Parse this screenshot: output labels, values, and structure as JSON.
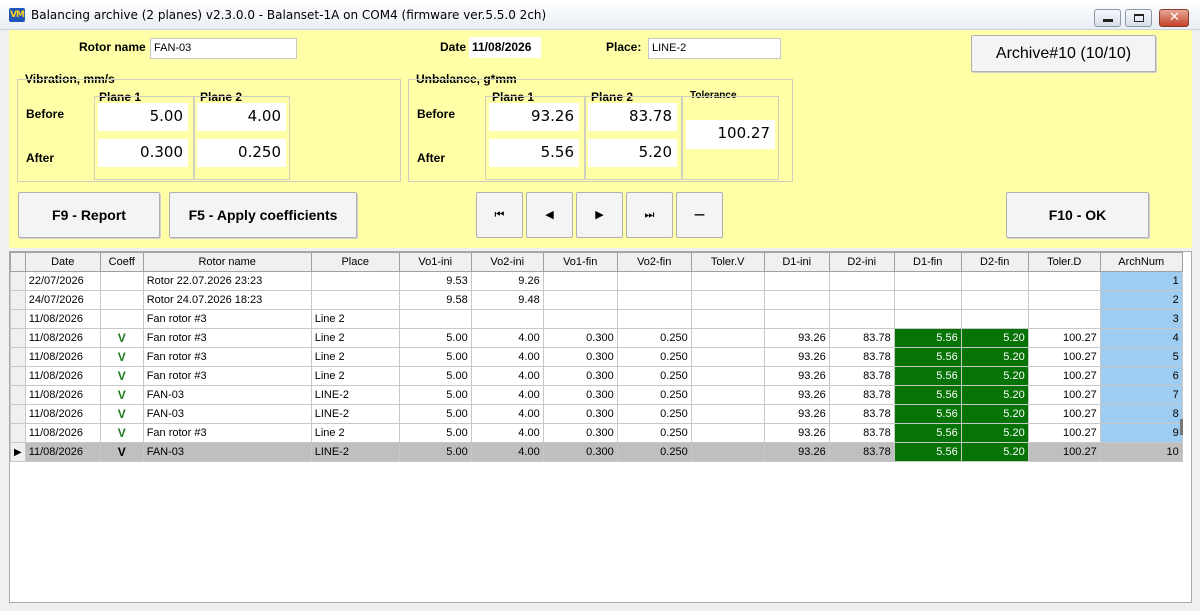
{
  "window": {
    "title": "Balancing archive (2 planes) v2.3.0.0 - Balanset-1A on COM4 (firmware ver.5.5.0 2ch)",
    "icon_text": "VM"
  },
  "header": {
    "rotor_name_label": "Rotor name",
    "rotor_name_value": "FAN-03",
    "date_label": "Date",
    "date_value": "11/08/2026",
    "place_label": "Place:",
    "place_value": "LINE-2",
    "archive_button": "Archive#10 (10/10)"
  },
  "vibration": {
    "title": "Vibration, mm/s",
    "plane1": "Plane 1",
    "plane2": "Plane 2",
    "before_label": "Before",
    "after_label": "After",
    "before_p1": "5.00",
    "before_p2": "4.00",
    "after_p1": "0.300",
    "after_p2": "0.250"
  },
  "unbalance": {
    "title": "Unbalance, g*mm",
    "plane1": "Plane 1",
    "plane2": "Plane 2",
    "tolerance_label": "Tolerance",
    "before_label": "Before",
    "after_label": "After",
    "before_p1": "93.26",
    "before_p2": "83.78",
    "after_p1": "5.56",
    "after_p2": "5.20",
    "tolerance": "100.27"
  },
  "buttons": {
    "report": "F9 - Report",
    "apply": "F5 - Apply coefficients",
    "ok": "F10 - OK",
    "nav_first": "⏮",
    "nav_prev": "◀",
    "nav_next": "▶",
    "nav_last": "⏭",
    "nav_delete": "—"
  },
  "grid": {
    "columns": [
      "Date",
      "Coeff",
      "Rotor name",
      "Place",
      "Vo1-ini",
      "Vo2-ini",
      "Vo1-fin",
      "Vo2-fin",
      "Toler.V",
      "D1-ini",
      "D2-ini",
      "D1-fin",
      "D2-fin",
      "Toler.D",
      "ArchNum"
    ],
    "selected_row_marker": "▶",
    "rows": [
      [
        "22/07/2026",
        "",
        "Rotor 22.07.2026 23:23",
        "",
        "9.53",
        "9.26",
        "",
        "",
        "",
        "",
        "",
        "",
        "",
        "",
        "1"
      ],
      [
        "24/07/2026",
        "",
        "Rotor 24.07.2026 18:23",
        "",
        "9.58",
        "9.48",
        "",
        "",
        "",
        "",
        "",
        "",
        "",
        "",
        "2"
      ],
      [
        "11/08/2026",
        "",
        "Fan rotor #3",
        "Line 2",
        "",
        "",
        "",
        "",
        "",
        "",
        "",
        "",
        "",
        "",
        "3"
      ],
      [
        "11/08/2026",
        "V",
        "Fan rotor #3",
        "Line 2",
        "5.00",
        "4.00",
        "0.300",
        "0.250",
        "",
        "93.26",
        "83.78",
        "5.56",
        "5.20",
        "100.27",
        "4"
      ],
      [
        "11/08/2026",
        "V",
        "Fan rotor #3",
        "Line 2",
        "5.00",
        "4.00",
        "0.300",
        "0.250",
        "",
        "93.26",
        "83.78",
        "5.56",
        "5.20",
        "100.27",
        "5"
      ],
      [
        "11/08/2026",
        "V",
        "Fan rotor #3",
        "Line 2",
        "5.00",
        "4.00",
        "0.300",
        "0.250",
        "",
        "93.26",
        "83.78",
        "5.56",
        "5.20",
        "100.27",
        "6"
      ],
      [
        "11/08/2026",
        "V",
        "FAN-03",
        "LINE-2",
        "5.00",
        "4.00",
        "0.300",
        "0.250",
        "",
        "93.26",
        "83.78",
        "5.56",
        "5.20",
        "100.27",
        "7"
      ],
      [
        "11/08/2026",
        "V",
        "FAN-03",
        "LINE-2",
        "5.00",
        "4.00",
        "0.300",
        "0.250",
        "",
        "93.26",
        "83.78",
        "5.56",
        "5.20",
        "100.27",
        "8"
      ],
      [
        "11/08/2026",
        "V",
        "Fan rotor #3",
        "Line 2",
        "5.00",
        "4.00",
        "0.300",
        "0.250",
        "",
        "93.26",
        "83.78",
        "5.56",
        "5.20",
        "100.27",
        "9"
      ],
      [
        "11/08/2026",
        "V",
        "FAN-03",
        "LINE-2",
        "5.00",
        "4.00",
        "0.300",
        "0.250",
        "",
        "93.26",
        "83.78",
        "5.56",
        "5.20",
        "100.27",
        "10"
      ]
    ],
    "selected_row_index": 9
  }
}
